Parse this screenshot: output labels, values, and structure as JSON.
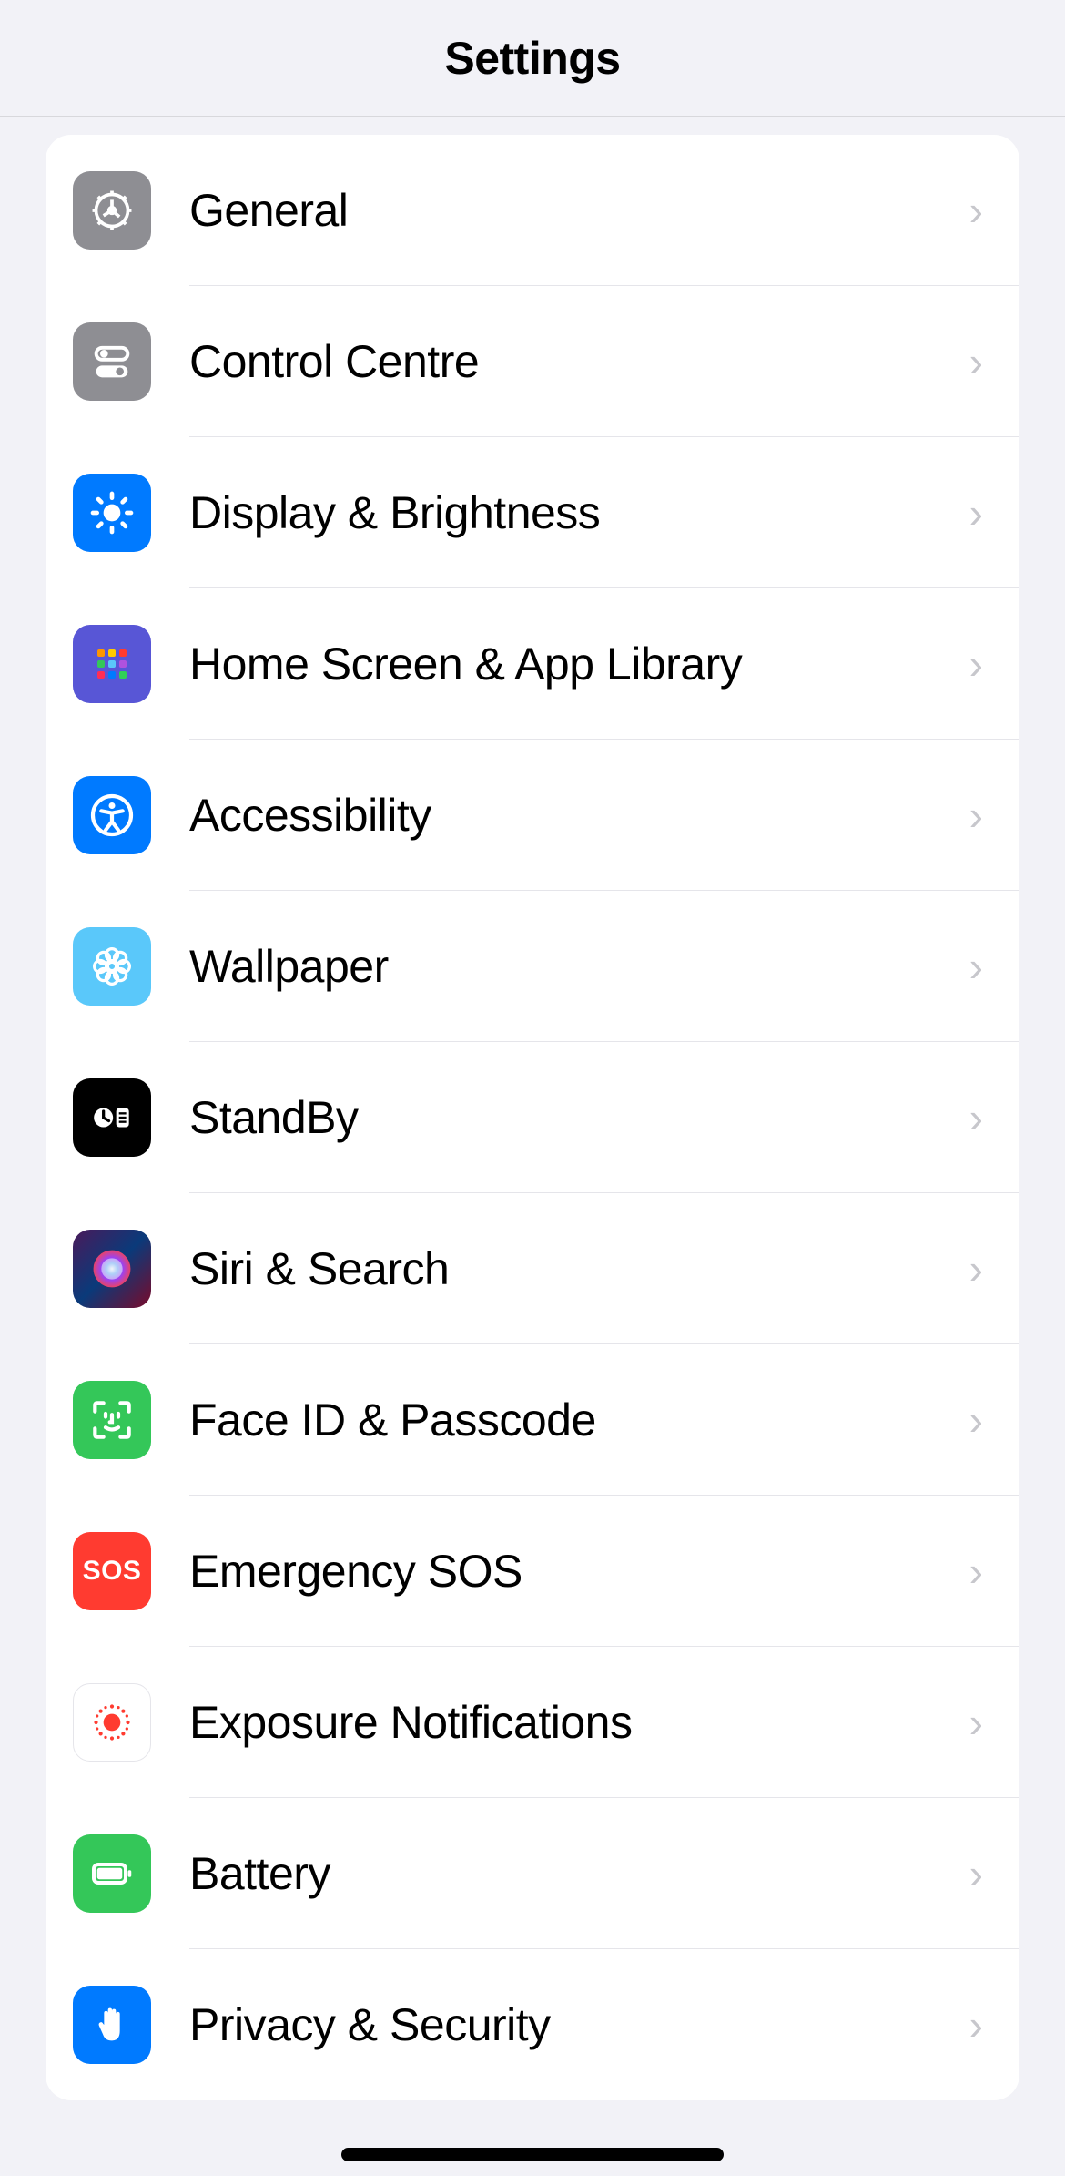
{
  "header": {
    "title": "Settings"
  },
  "items": [
    {
      "label": "General"
    },
    {
      "label": "Control Centre"
    },
    {
      "label": "Display & Brightness"
    },
    {
      "label": "Home Screen & App Library"
    },
    {
      "label": "Accessibility"
    },
    {
      "label": "Wallpaper"
    },
    {
      "label": "StandBy"
    },
    {
      "label": "Siri & Search"
    },
    {
      "label": "Face ID & Passcode"
    },
    {
      "label": "Emergency SOS"
    },
    {
      "label": "Exposure Notifications"
    },
    {
      "label": "Battery"
    },
    {
      "label": "Privacy & Security"
    }
  ]
}
